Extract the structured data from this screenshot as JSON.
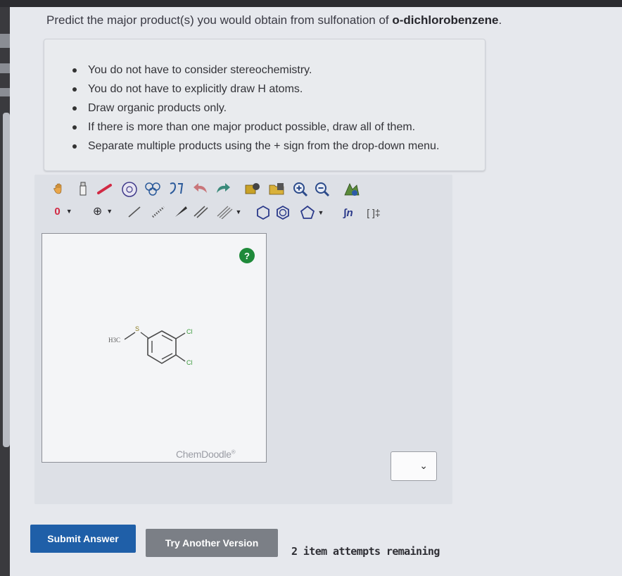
{
  "question": {
    "prefix": "Predict the major product(s) you would obtain from sulfonation of ",
    "compound": "o-dichlorobenzene",
    "suffix": "."
  },
  "instructions": [
    "You do not have to consider stereochemistry.",
    "You do not have to explicitly draw H atoms.",
    "Draw organic products only.",
    "If there is more than one major product possible, draw all of them.",
    "Separate multiple products using the + sign from the drop-down menu."
  ],
  "toolbar": {
    "charge_label": "0",
    "charge_plus": "⊕",
    "template_label": "∫n",
    "bracket_label": "[ ]‡"
  },
  "canvas": {
    "help_label": "?",
    "watermark": "ChemDoodle",
    "watermark_mark": "®",
    "molecule": {
      "methyl_label": "H3C",
      "sulfur_label": "S",
      "cl1_label": "Cl",
      "cl2_label": "Cl"
    }
  },
  "dropdown": {
    "selected": ""
  },
  "actions": {
    "submit_label": "Submit Answer",
    "try_label": "Try Another Version",
    "attempts_text": "2 item attempts remaining"
  },
  "colors": {
    "submit": "#1f5fa8",
    "try_another": "#7b7f86",
    "help": "#1f8a3a"
  }
}
